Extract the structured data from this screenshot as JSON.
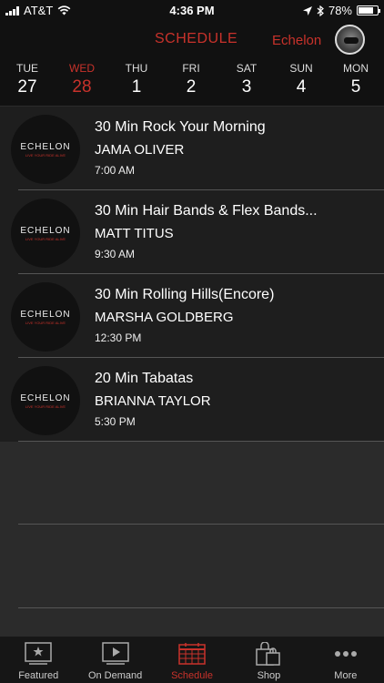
{
  "status_bar": {
    "carrier": "AT&T",
    "time": "4:36 PM",
    "battery": "78%",
    "battery_level": 0.78
  },
  "header": {
    "title": "SCHEDULE",
    "brand": "Echelon"
  },
  "days": [
    {
      "dow": "TUE",
      "num": "27",
      "active": false
    },
    {
      "dow": "WED",
      "num": "28",
      "active": true
    },
    {
      "dow": "THU",
      "num": "1",
      "active": false
    },
    {
      "dow": "FRI",
      "num": "2",
      "active": false
    },
    {
      "dow": "SAT",
      "num": "3",
      "active": false
    },
    {
      "dow": "SUN",
      "num": "4",
      "active": false
    },
    {
      "dow": "MON",
      "num": "5",
      "active": false
    }
  ],
  "logo": {
    "word": "ECHELON",
    "tag": "LIVE YOUR RIDE ALIVE"
  },
  "classes": [
    {
      "title": "30 Min Rock Your Morning",
      "instructor": "JAMA OLIVER",
      "time": "7:00 AM"
    },
    {
      "title": "30 Min Hair Bands & Flex Bands...",
      "instructor": "MATT TITUS",
      "time": "9:30 AM"
    },
    {
      "title": "30 Min Rolling Hills(Encore)",
      "instructor": "MARSHA GOLDBERG",
      "time": "12:30 PM"
    },
    {
      "title": "20 Min Tabatas",
      "instructor": "BRIANNA TAYLOR",
      "time": "5:30 PM"
    }
  ],
  "tabs": [
    {
      "label": "Featured",
      "icon": "featured-icon",
      "active": false
    },
    {
      "label": "On Demand",
      "icon": "on-demand-icon",
      "active": false
    },
    {
      "label": "Schedule",
      "icon": "calendar-icon",
      "active": true
    },
    {
      "label": "Shop",
      "icon": "shopping-bag-icon",
      "active": false
    },
    {
      "label": "More",
      "icon": "more-dots-icon",
      "active": false
    }
  ],
  "colors": {
    "accent": "#c8322b",
    "background": "#2b2b2b",
    "row_background": "#1e1e1e",
    "bar_background": "#111111"
  }
}
